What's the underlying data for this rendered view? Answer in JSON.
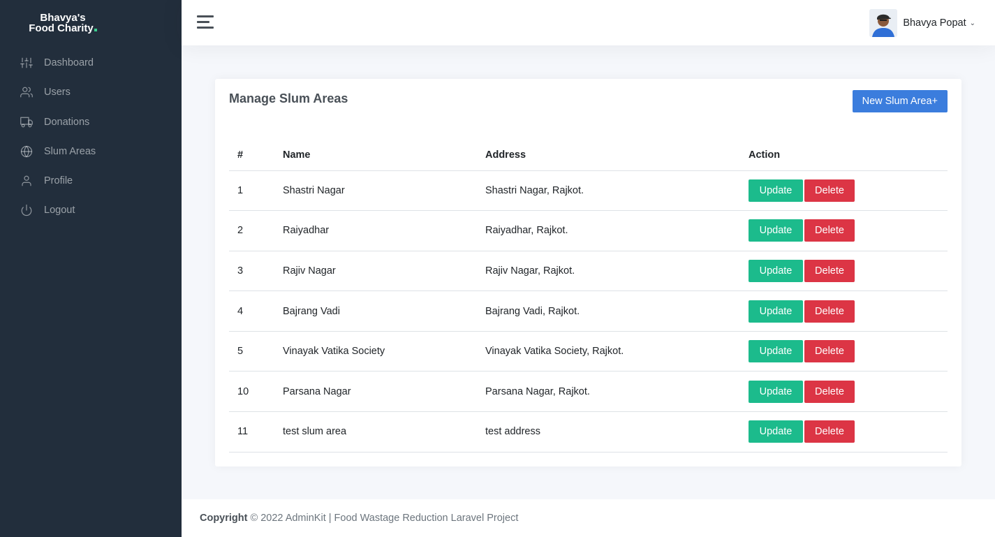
{
  "brand": {
    "line1": "Bhavya's",
    "line2": "Food Charity"
  },
  "sidebar": {
    "items": [
      {
        "label": "Dashboard",
        "icon": "sliders-icon"
      },
      {
        "label": "Users",
        "icon": "users-icon"
      },
      {
        "label": "Donations",
        "icon": "truck-icon"
      },
      {
        "label": "Slum Areas",
        "icon": "globe-icon"
      },
      {
        "label": "Profile",
        "icon": "user-icon"
      },
      {
        "label": "Logout",
        "icon": "power-icon"
      }
    ]
  },
  "topbar": {
    "user_name": "Bhavya Popat"
  },
  "card": {
    "title": "Manage Slum Areas",
    "new_button": "New Slum Area+",
    "columns": [
      "#",
      "Name",
      "Address",
      "Action"
    ],
    "rows": [
      {
        "id": "1",
        "name": "Shastri Nagar",
        "address": "Shastri Nagar, Rajkot."
      },
      {
        "id": "2",
        "name": "Raiyadhar",
        "address": "Raiyadhar, Rajkot."
      },
      {
        "id": "3",
        "name": "Rajiv Nagar",
        "address": "Rajiv Nagar, Rajkot."
      },
      {
        "id": "4",
        "name": "Bajrang Vadi",
        "address": "Bajrang Vadi, Rajkot."
      },
      {
        "id": "5",
        "name": "Vinayak Vatika Society",
        "address": "Vinayak Vatika Society, Rajkot."
      },
      {
        "id": "10",
        "name": "Parsana Nagar",
        "address": "Parsana Nagar, Rajkot."
      },
      {
        "id": "11",
        "name": "test slum area",
        "address": "test address"
      }
    ],
    "update_label": "Update",
    "delete_label": "Delete"
  },
  "footer": {
    "copyright_label": "Copyright",
    "text": " © 2022 AdminKit | Food Wastage Reduction Laravel Project"
  },
  "colors": {
    "sidebar": "#222e3c",
    "primary": "#3b7ddd",
    "success": "#1cbb8c",
    "danger": "#dc3545"
  }
}
